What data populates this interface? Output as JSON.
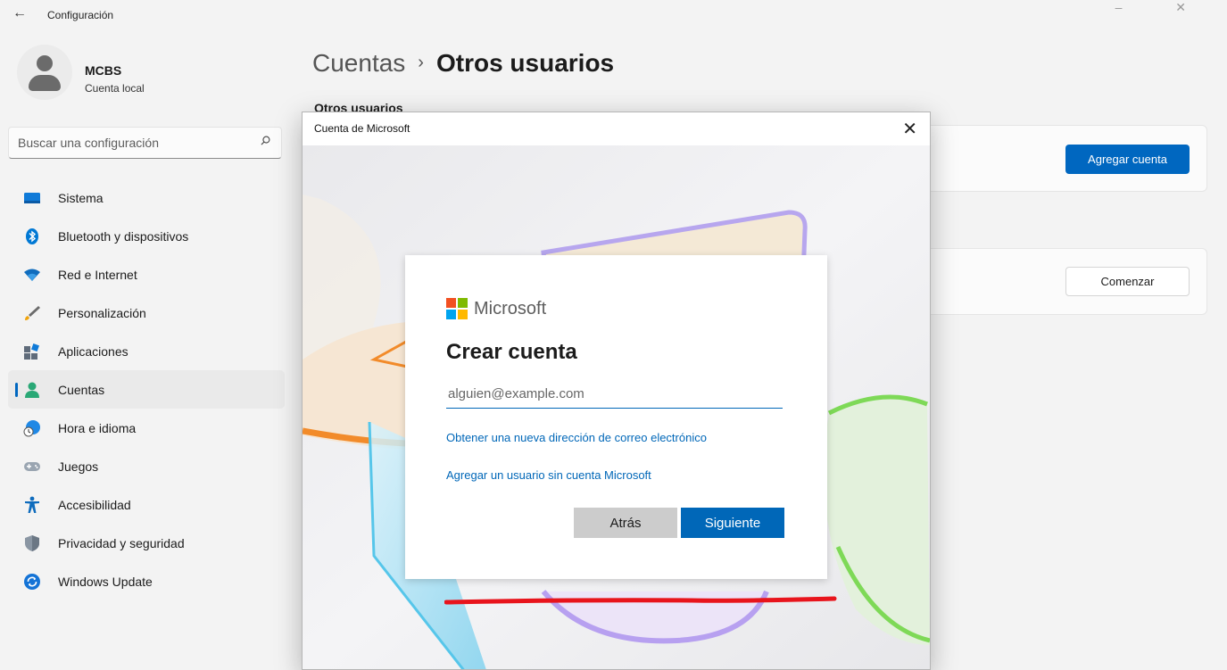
{
  "window": {
    "title": "Configuración",
    "back_glyph": "←",
    "controls_glyphs": "– ✕"
  },
  "user": {
    "name": "MCBS",
    "account_type": "Cuenta local"
  },
  "search": {
    "placeholder": "Buscar una configuración",
    "value": ""
  },
  "sidebar": {
    "items": [
      {
        "label": "Sistema",
        "icon": "system-icon"
      },
      {
        "label": "Bluetooth y dispositivos",
        "icon": "bluetooth-icon"
      },
      {
        "label": "Red e Internet",
        "icon": "wifi-icon"
      },
      {
        "label": "Personalización",
        "icon": "brush-icon"
      },
      {
        "label": "Aplicaciones",
        "icon": "apps-icon"
      },
      {
        "label": "Cuentas",
        "icon": "accounts-icon",
        "active": true
      },
      {
        "label": "Hora e idioma",
        "icon": "clock-globe-icon"
      },
      {
        "label": "Juegos",
        "icon": "gamepad-icon"
      },
      {
        "label": "Accesibilidad",
        "icon": "accessibility-icon"
      },
      {
        "label": "Privacidad y seguridad",
        "icon": "shield-icon"
      },
      {
        "label": "Windows Update",
        "icon": "update-icon"
      }
    ]
  },
  "main": {
    "breadcrumb_parent": "Cuentas",
    "breadcrumb_separator": "›",
    "breadcrumb_current": "Otros usuarios",
    "section_label": "Otros usuarios",
    "add_account_button": "Agregar cuenta",
    "start_button": "Comenzar"
  },
  "dialog": {
    "title": "Cuenta de Microsoft",
    "close_glyph": "✕",
    "brand": "Microsoft",
    "heading": "Crear cuenta",
    "email_placeholder": "alguien@example.com",
    "email_value": "",
    "new_email_link": "Obtener una nueva dirección de correo electrónico",
    "no_ms_account_link": "Agregar un usuario sin cuenta Microsoft",
    "back_button": "Atrás",
    "next_button": "Siguiente"
  },
  "colors": {
    "accent": "#0067c0",
    "ms_blue": "#0067b8",
    "annotation_red": "#e8141c",
    "ms_logo": [
      "#f25022",
      "#7fba00",
      "#00a4ef",
      "#ffb900"
    ]
  }
}
